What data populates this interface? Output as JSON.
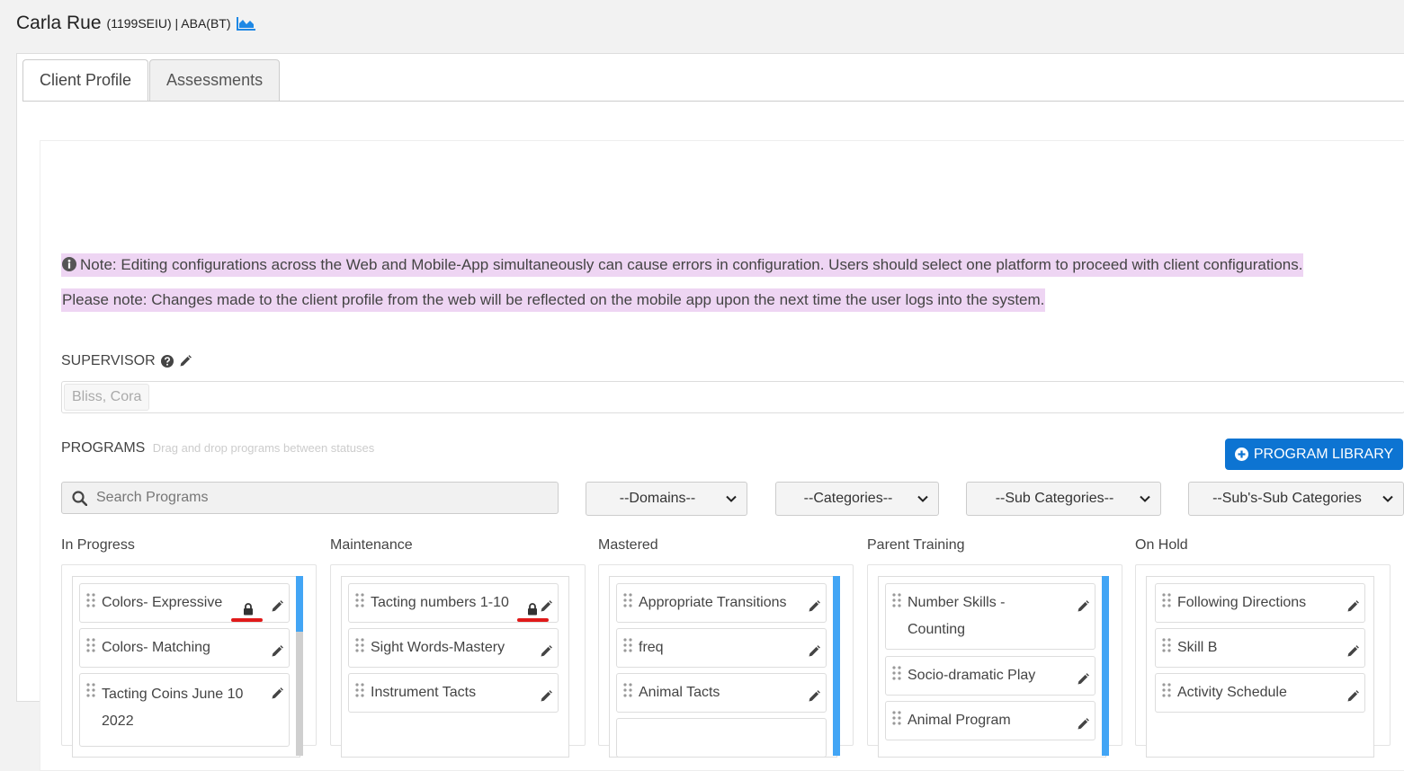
{
  "header": {
    "client_name": "Carla Rue",
    "client_meta": "(1199SEIU) | ABA(BT)",
    "chart_icon": "area-chart-icon"
  },
  "tabs": [
    {
      "label": "Client Profile",
      "active": true
    },
    {
      "label": "Assessments",
      "active": false
    }
  ],
  "notes": {
    "note1": "Note: Editing configurations across the Web and Mobile-App simultaneously can cause errors in configuration. Users should select one platform to proceed with client configurations.",
    "note2": "Please note: Changes made to the client profile from the web will be reflected on the mobile app upon the next time the user logs into the system.",
    "highlight_color": "#eed5f3"
  },
  "supervisor": {
    "label": "SUPERVISOR",
    "selected": "Bliss, Cora"
  },
  "programs": {
    "label": "PROGRAMS",
    "hint": "Drag and drop programs between statuses",
    "library_button": "PROGRAM LIBRARY",
    "library_button_color": "#0d74d2",
    "search_placeholder": "Search Programs",
    "filters": {
      "domains": "--Domains--",
      "categories": "--Categories--",
      "sub_categories": "--Sub Categories--",
      "subs_sub_categories": "--Sub's-Sub Categories"
    }
  },
  "columns": [
    {
      "title": "In Progress",
      "items": [
        {
          "name": "Colors- Expressive",
          "locked": true
        },
        {
          "name": "Colors- Matching",
          "locked": false
        },
        {
          "name": "Tacting Coins June 10 2022",
          "locked": false
        }
      ]
    },
    {
      "title": "Maintenance",
      "items": [
        {
          "name": "Tacting numbers 1-10",
          "locked": true
        },
        {
          "name": "Sight Words-Mastery",
          "locked": false
        },
        {
          "name": "Instrument Tacts",
          "locked": false
        }
      ]
    },
    {
      "title": "Mastered",
      "items": [
        {
          "name": "Appropriate Transitions",
          "locked": false
        },
        {
          "name": "freq",
          "locked": false
        },
        {
          "name": "Animal Tacts",
          "locked": false
        }
      ]
    },
    {
      "title": "Parent Training",
      "items": [
        {
          "name": "Number Skills - Counting",
          "locked": false
        },
        {
          "name": "Socio-dramatic Play",
          "locked": false
        },
        {
          "name": "Animal Program",
          "locked": false
        }
      ]
    },
    {
      "title": "On Hold",
      "items": [
        {
          "name": "Following Directions",
          "locked": false
        },
        {
          "name": "Skill B",
          "locked": false
        },
        {
          "name": "Activity Schedule",
          "locked": false
        }
      ]
    }
  ],
  "accent_colors": {
    "scrollbar": "#42a5f5",
    "lock_marker": "#e01a1a"
  }
}
